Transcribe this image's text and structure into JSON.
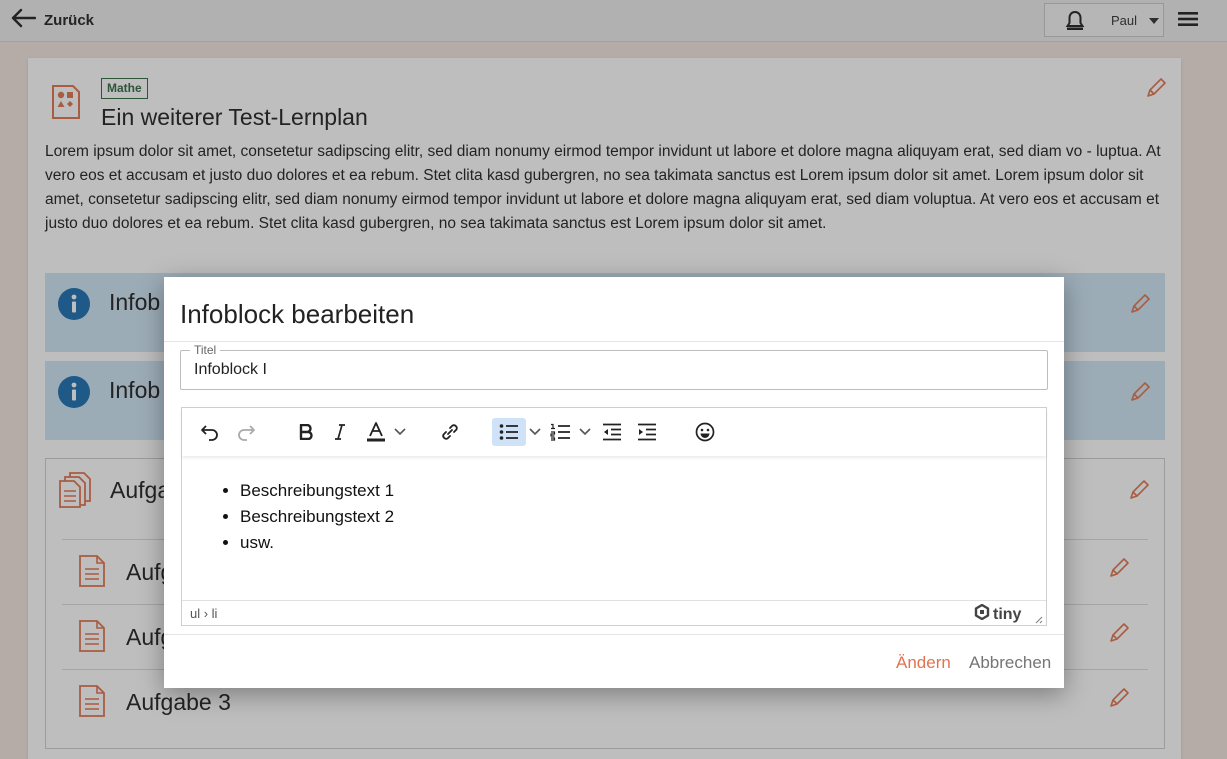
{
  "topbar": {
    "back_label": "Zurück",
    "user_name": "Paul",
    "icons": [
      "arrow-left-icon",
      "bell-icon",
      "hamburger-menu-icon"
    ]
  },
  "plan": {
    "subject_tag": "Mathe",
    "title": "Ein weiterer Test-Lernplan",
    "description": "Lorem ipsum dolor sit amet, consetetur sadipscing elitr, sed diam nonumy eirmod tempor invidunt ut labore et dolore magna aliquyam erat, sed diam vo - luptua. At vero eos et accusam et justo duo dolores et ea rebum. Stet clita kasd gubergren, no sea takimata sanctus est Lorem ipsum dolor sit amet. Lorem ipsum dolor sit amet, consetetur sadipscing elitr, sed diam nonumy eirmod tempor invidunt ut labore et dolore magna aliquyam erat, sed diam voluptua. At vero eos et accusam et justo duo dolores et ea rebum. Stet clita kasd gubergren, no sea takimata sanctus est Lorem ipsum dolor sit amet."
  },
  "infoblocks": [
    {
      "label": "Infob"
    },
    {
      "label": "Infob"
    }
  ],
  "tasks_block": {
    "label": "Aufga"
  },
  "tasks": [
    {
      "label": "Aufg"
    },
    {
      "label": "Aufg"
    },
    {
      "label": "Aufgabe 3"
    }
  ],
  "dialog": {
    "title": "Infoblock bearbeiten",
    "field_label": "Titel",
    "field_value": "Infoblock I",
    "editor": {
      "list_items": [
        "Beschreibungstext 1",
        "Beschreibungstext 2",
        "usw."
      ],
      "status_path": "ul › li",
      "brand": "tiny",
      "toolbar_icons": [
        "undo-icon",
        "redo-icon",
        "bold-icon",
        "italic-icon",
        "text-color-icon",
        "chevron-down-icon",
        "link-icon",
        "bullet-list-icon",
        "chevron-down-icon",
        "numbered-list-icon",
        "chevron-down-icon",
        "outdent-icon",
        "indent-icon",
        "emoji-icon"
      ]
    },
    "save_label": "Ändern",
    "cancel_label": "Abbrechen"
  },
  "colors": {
    "accent": "#e0734e",
    "info_bg": "#cfe6f5",
    "info_icon": "#1c6fb0",
    "tag": "#2e6b3e",
    "active_tool": "#cfe2f8"
  }
}
